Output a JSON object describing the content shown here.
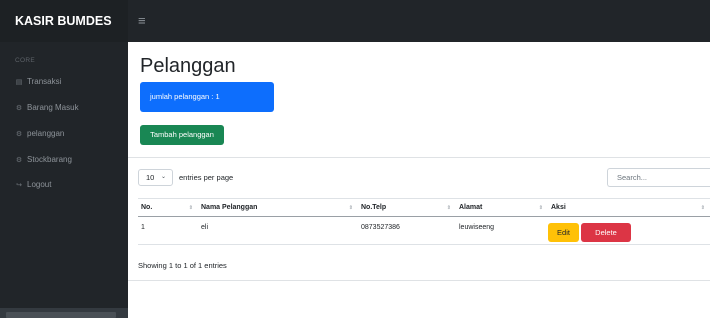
{
  "brand": "KASIR BUMDES",
  "toggle_icon": "≡",
  "sidebar": {
    "heading": "CORE",
    "items": [
      {
        "icon": "▤",
        "label": "Transaksi"
      },
      {
        "icon": "⚙",
        "label": "Barang Masuk"
      },
      {
        "icon": "⚙",
        "label": "pelanggan"
      },
      {
        "icon": "⚙",
        "label": "Stockbarang"
      },
      {
        "icon": "↪",
        "label": "Logout"
      }
    ]
  },
  "main": {
    "title": "Pelanggan",
    "stat_card": "jumlah pelanggan : 1",
    "add_button": "Tambah pelanggan"
  },
  "datatable": {
    "per_page_value": "10",
    "per_page_chevron": "⌄",
    "per_page_label": "entries per page",
    "search_placeholder": "Search...",
    "sort_icon": "⇕",
    "columns": [
      "No.",
      "Nama Pelanggan",
      "No.Telp",
      "Alamat",
      "Aksi"
    ],
    "rows": [
      {
        "no": "1",
        "nama": "eli",
        "telp": "0873527386",
        "alamat": "leuwiseeng",
        "edit": "Edit",
        "delete": "Delete"
      }
    ],
    "info": "Showing 1 to 1 of 1 entries"
  },
  "colors": {
    "sidebar_bg": "#212529",
    "primary": "#0d6efd",
    "success": "#198754",
    "warning": "#ffc107",
    "danger": "#dc3545"
  }
}
